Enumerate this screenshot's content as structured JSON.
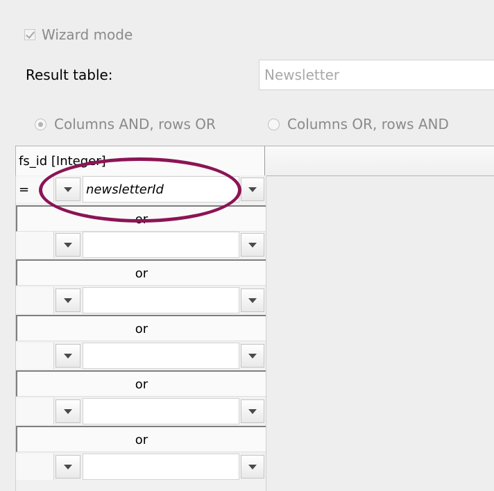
{
  "wizard_mode": {
    "label": "Wizard mode",
    "checked": true
  },
  "result_table": {
    "label": "Result table:",
    "value": "Newsletter"
  },
  "combine_mode": {
    "options": [
      "Columns AND, rows OR",
      "Columns OR, rows AND"
    ],
    "selected": "Columns AND, rows OR"
  },
  "grid": {
    "column_header": "fs_id [Integer]",
    "rows": [
      {
        "operator": "=",
        "value": "newsletterId"
      },
      {
        "operator": "",
        "value": ""
      },
      {
        "operator": "",
        "value": ""
      },
      {
        "operator": "",
        "value": ""
      },
      {
        "operator": "",
        "value": ""
      },
      {
        "operator": "",
        "value": ""
      }
    ],
    "separator_label": "or"
  },
  "colors": {
    "highlight": "#8b1455"
  }
}
